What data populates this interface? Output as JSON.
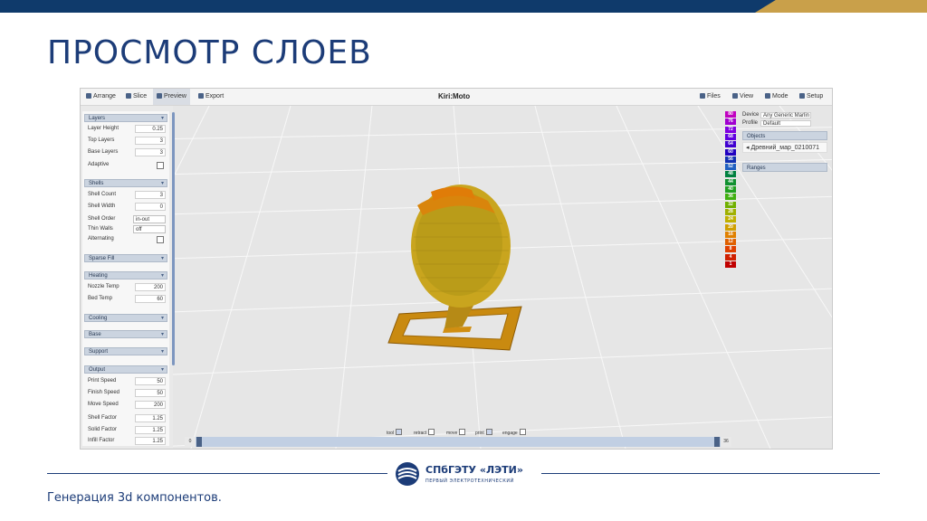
{
  "slide": {
    "title": "ПРОСМОТР СЛОЕВ",
    "footer": "Генерация 3d компонентов.",
    "logo_name": "СПбГЭТУ «ЛЭТИ»",
    "logo_subtitle": "ПЕРВЫЙ ЭЛЕКТРОТЕХНИЧЕСКИЙ"
  },
  "app": {
    "brand": "Kiri:Moto",
    "tabs": [
      {
        "label": "Arrange",
        "icon": "arrange-icon"
      },
      {
        "label": "Slice",
        "icon": "slice-icon"
      },
      {
        "label": "Preview",
        "icon": "preview-icon"
      },
      {
        "label": "Export",
        "icon": "export-icon"
      }
    ],
    "active_tab": "Preview",
    "menus": [
      {
        "label": "Files",
        "icon": "folder-icon"
      },
      {
        "label": "View",
        "icon": "eye-icon"
      },
      {
        "label": "Mode",
        "icon": "mode-icon"
      },
      {
        "label": "Setup",
        "icon": "gear-icon"
      }
    ]
  },
  "left_panel": {
    "layers": {
      "title": "Layers",
      "layer_height_label": "Layer Height",
      "layer_height": "0.25",
      "top_layers_label": "Top Layers",
      "top_layers": "3",
      "base_layers_label": "Base Layers",
      "base_layers": "3",
      "adaptive_label": "Adaptive"
    },
    "shells": {
      "title": "Shells",
      "shell_count_label": "Shell Count",
      "shell_count": "3",
      "shell_width_label": "Shell Width",
      "shell_width": "0",
      "shell_order_label": "Shell Order",
      "shell_order": "in-out",
      "thin_walls_label": "Thin Walls",
      "thin_walls": "off",
      "alternating_label": "Alternating"
    },
    "sparse_fill": {
      "title": "Sparse Fill"
    },
    "heating": {
      "title": "Heating",
      "nozzle_temp_label": "Nozzle Temp",
      "nozzle_temp": "200",
      "bed_temp_label": "Bed Temp",
      "bed_temp": "60"
    },
    "cooling": {
      "title": "Cooling"
    },
    "raft": {
      "title": "Base"
    },
    "support": {
      "title": "Support"
    },
    "output": {
      "title": "Output",
      "print_speed_label": "Print Speed",
      "print_speed": "50",
      "finish_speed_label": "Finish Speed",
      "finish_speed": "50",
      "move_speed_label": "Move Speed",
      "move_speed": "200",
      "shell_factor_label": "Shell Factor",
      "shell_factor": "1.25",
      "solid_factor_label": "Solid Factor",
      "solid_factor": "1.25",
      "infill_factor_label": "Infill Factor",
      "infill_factor": "1.25"
    }
  },
  "right_panel": {
    "device_label": "Device",
    "device": "Any Generic Marlin",
    "profile_label": "Profile",
    "profile": "Default",
    "objects_title": "Objects",
    "object_name": "Древний_мар_0210071",
    "ranges_title": "Ranges"
  },
  "layer_colors": [
    {
      "label": "80",
      "color": "#c000c0"
    },
    {
      "label": "76",
      "color": "#a000d0"
    },
    {
      "label": "72",
      "color": "#8000e0"
    },
    {
      "label": "68",
      "color": "#6000e0"
    },
    {
      "label": "64",
      "color": "#4000d0"
    },
    {
      "label": "60",
      "color": "#2000c0"
    },
    {
      "label": "56",
      "color": "#1030b0"
    },
    {
      "label": "52",
      "color": "#2060c0"
    },
    {
      "label": "48",
      "color": "#008040"
    },
    {
      "label": "44",
      "color": "#109030"
    },
    {
      "label": "40",
      "color": "#20a020"
    },
    {
      "label": "36",
      "color": "#40b010"
    },
    {
      "label": "32",
      "color": "#70b000"
    },
    {
      "label": "28",
      "color": "#a0b000"
    },
    {
      "label": "24",
      "color": "#c0b000"
    },
    {
      "label": "20",
      "color": "#d0a000"
    },
    {
      "label": "16",
      "color": "#e08000"
    },
    {
      "label": "12",
      "color": "#e06000"
    },
    {
      "label": "8",
      "color": "#e04000"
    },
    {
      "label": "4",
      "color": "#d02000"
    },
    {
      "label": "1",
      "color": "#c00000"
    }
  ],
  "view_options": {
    "tool_label": "tool",
    "tool_checked": true,
    "retract_label": "retract",
    "retract_checked": false,
    "move_label": "move",
    "move_checked": false,
    "print_label": "print",
    "print_checked": true,
    "engage_label": "engage",
    "engage_checked": false
  },
  "layer_slider": {
    "min_label": "0",
    "max_label": "36",
    "low": 0,
    "high": 36
  }
}
